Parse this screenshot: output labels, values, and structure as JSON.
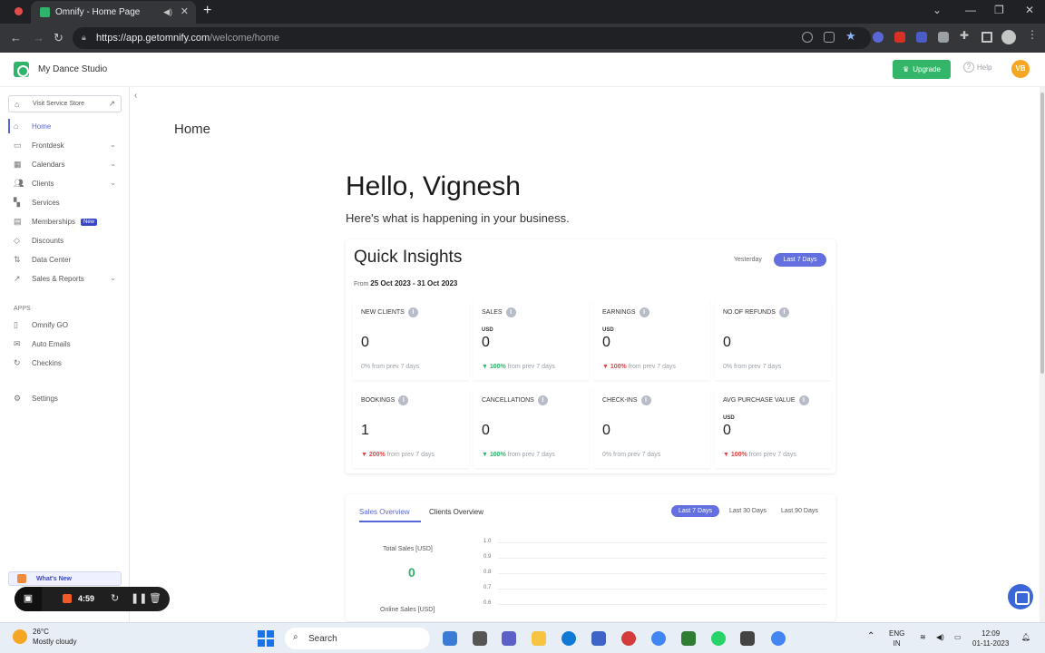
{
  "browser": {
    "tab_title": "Omnify - Home Page",
    "url_host": "https://app.getomnify.com",
    "url_path": "/welcome/home"
  },
  "header": {
    "studio_name": "My Dance Studio",
    "upgrade_label": "Upgrade",
    "help_label": "Help",
    "avatar_initials": "VB"
  },
  "sidebar": {
    "store_label": "Visit Service Store",
    "items": [
      {
        "label": "Home"
      },
      {
        "label": "Frontdesk"
      },
      {
        "label": "Calendars"
      },
      {
        "label": "Clients"
      },
      {
        "label": "Services"
      },
      {
        "label": "Memberships",
        "badge": "New"
      },
      {
        "label": "Discounts"
      },
      {
        "label": "Data Center"
      },
      {
        "label": "Sales & Reports"
      }
    ],
    "apps_label": "APPS",
    "apps": [
      {
        "label": "Omnify GO"
      },
      {
        "label": "Auto Emails"
      },
      {
        "label": "Checkins"
      }
    ],
    "settings_label": "Settings",
    "whats_new_label": "What's New"
  },
  "recorder": {
    "time": "4:59"
  },
  "main": {
    "page_title": "Home",
    "greeting": "Hello, Vignesh",
    "subtitle": "Here's what is happening in your business.",
    "insights": {
      "title": "Quick Insights",
      "range_prefix": "From",
      "range": "25 Oct 2023 - 31 Oct 2023",
      "toggle_yesterday": "Yesterday",
      "toggle_7days": "Last 7 Days",
      "metrics": [
        {
          "label": "NEW CLIENTS",
          "currency": "",
          "value": "0",
          "pct": "",
          "dir": "",
          "suffix": "0% from prev 7 days"
        },
        {
          "label": "SALES",
          "currency": "USD",
          "value": "0",
          "pct": "100%",
          "dir": "down",
          "suffix": " from prev 7 days"
        },
        {
          "label": "EARNINGS",
          "currency": "USD",
          "value": "0",
          "pct": "100%",
          "dir": "up",
          "suffix": " from prev 7 days"
        },
        {
          "label": "NO.OF REFUNDS",
          "currency": "",
          "value": "0",
          "pct": "",
          "dir": "",
          "suffix": "0% from prev 7 days"
        },
        {
          "label": "BOOKINGS",
          "currency": "",
          "value": "1",
          "pct": "200%",
          "dir": "up",
          "suffix": " from prev 7 days"
        },
        {
          "label": "CANCELLATIONS",
          "currency": "",
          "value": "0",
          "pct": "100%",
          "dir": "down",
          "suffix": " from prev 7 days"
        },
        {
          "label": "CHECK-INS",
          "currency": "",
          "value": "0",
          "pct": "",
          "dir": "",
          "suffix": "0% from prev 7 days"
        },
        {
          "label": "AVG PURCHASE VALUE",
          "currency": "USD",
          "value": "0",
          "pct": "100%",
          "dir": "up",
          "suffix": " from prev 7 days"
        }
      ]
    },
    "overview": {
      "tab_sales": "Sales Overview",
      "tab_clients": "Clients Overview",
      "ranges": [
        "Last 7 Days",
        "Last 30 Days",
        "Last 90 Days"
      ],
      "total_sales_label": "Total Sales [USD]",
      "total_sales_value": "0",
      "online_sales_label": "Online Sales [USD]",
      "y_ticks": [
        "1.0",
        "0.9",
        "0.8",
        "0.7",
        "0.6"
      ]
    }
  },
  "taskbar": {
    "temp": "26°C",
    "weather": "Mostly cloudy",
    "search_label": "Search",
    "lang": "ENG",
    "region": "IN",
    "time": "12:09",
    "date": "01-11-2023"
  },
  "colors": {
    "brand_green": "#2fb46b",
    "accent": "#6470e0",
    "up_red": "#e04545"
  }
}
